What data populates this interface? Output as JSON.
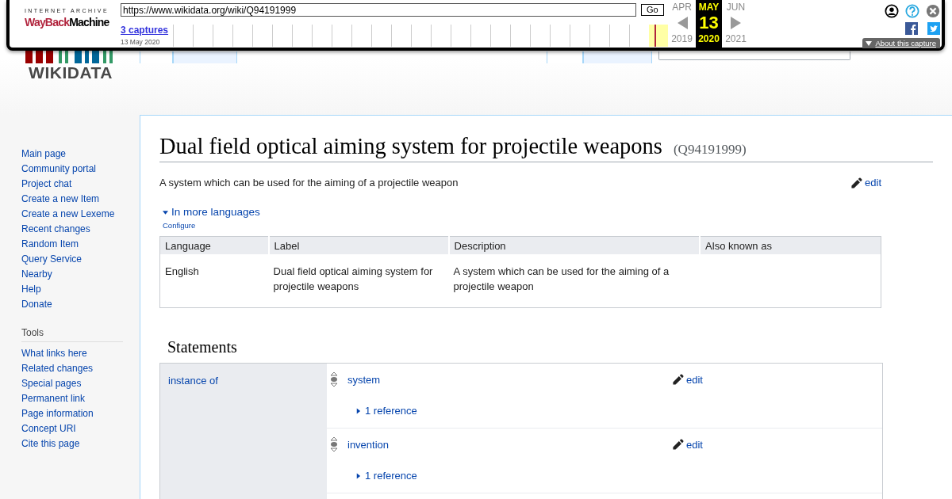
{
  "wayback": {
    "org": "INTERNET ARCHIVE",
    "brand_left": "WayBack",
    "brand_right": "Machine",
    "url": "https://www.wikidata.org/wiki/Q94191999",
    "go": "Go",
    "captures": "3 captures",
    "capture_date": "13 May 2020",
    "months": [
      {
        "month": "APR",
        "year": "2019",
        "selected": false
      },
      {
        "month": "MAY",
        "day": "13",
        "year": "2020",
        "selected": true
      },
      {
        "month": "JUN",
        "year": "2021",
        "selected": false
      }
    ],
    "about": "About this capture"
  },
  "logo": {
    "wordmark": "WIKIDATA"
  },
  "sidebar": {
    "navigation": [
      "Main page",
      "Community portal",
      "Project chat",
      "Create a new Item",
      "Create a new Lexeme",
      "Recent changes",
      "Random Item",
      "Query Service",
      "Nearby",
      "Help",
      "Donate"
    ],
    "tools": {
      "heading": "Tools",
      "items": [
        "What links here",
        "Related changes",
        "Special pages",
        "Permanent link",
        "Page information",
        "Concept URI",
        "Cite this page"
      ]
    }
  },
  "content": {
    "title": "Dual field optical aiming system for projectile weapons",
    "qid": "(Q94191999)",
    "description": "A system which can be used for the aiming of a projectile weapon",
    "edit": "edit",
    "languages": {
      "toggle": "In more languages",
      "expanded": true,
      "configure": "Configure",
      "columns": [
        "Language",
        "Label",
        "Description",
        "Also known as"
      ],
      "rows": [
        [
          "English",
          "Dual field optical aiming system for projectile weapons",
          "A system which can be used for the aiming of a projectile weapon",
          ""
        ]
      ]
    },
    "statements": {
      "heading": "Statements",
      "groups": [
        {
          "property": "instance of",
          "values": [
            {
              "value": "system",
              "edit": "edit",
              "references": "1 reference"
            },
            {
              "value": "invention",
              "edit": "edit",
              "references": "1 reference"
            }
          ]
        }
      ]
    }
  }
}
